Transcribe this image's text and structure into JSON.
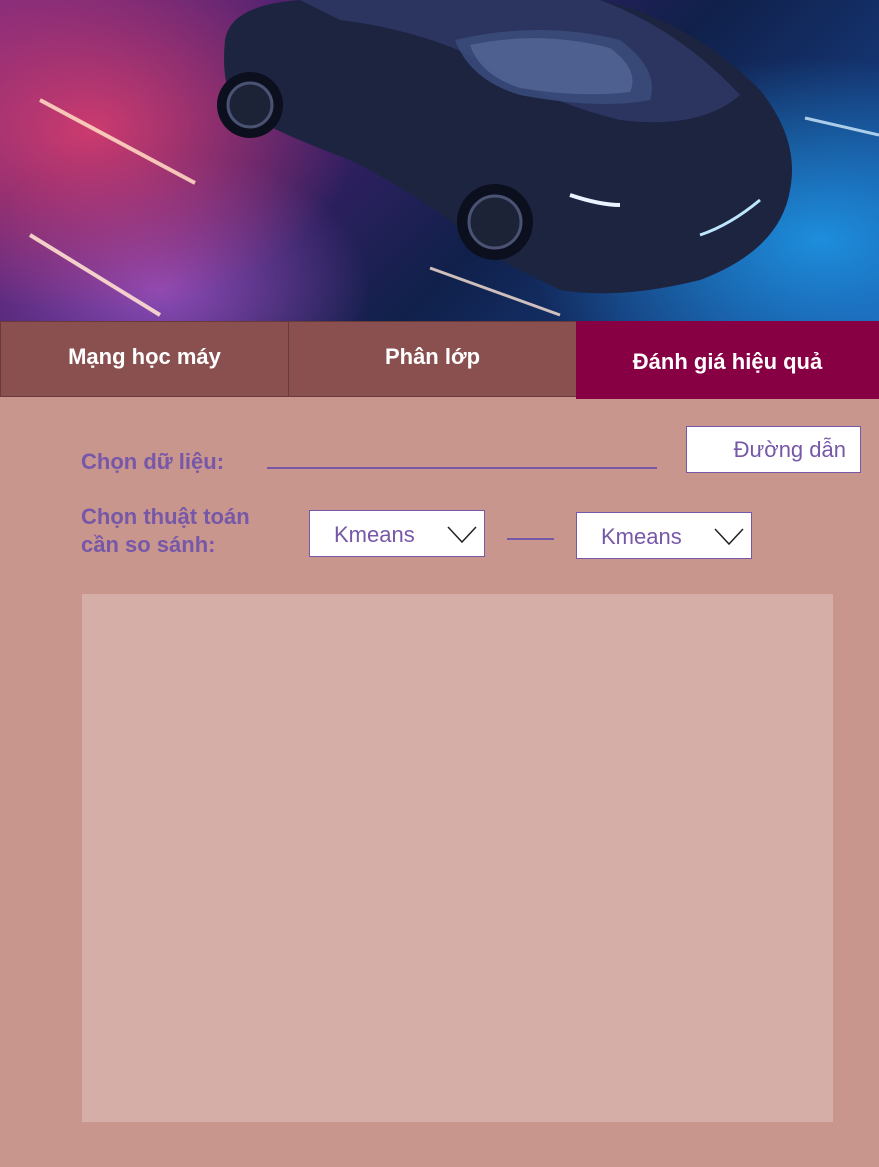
{
  "tabs": [
    {
      "label": "Mạng học máy"
    },
    {
      "label": "Phân lớp"
    },
    {
      "label": "Đánh giá hiệu quả"
    }
  ],
  "active_tab": "Đánh giá hiệu quả",
  "data_section": {
    "label": "Chọn dữ liệu:",
    "path_button": "Đường dẫn",
    "path_value": ""
  },
  "compare_section": {
    "label_line1": "Chọn thuật toán",
    "label_line2": "cần so sánh:",
    "algorithm_a": "Kmeans",
    "algorithm_b": "Kmeans"
  },
  "colors": {
    "background": "#c9968e",
    "tab": "#8a5050",
    "tab_active": "#880044",
    "accent": "#7657a8",
    "panel": "#d6aea8"
  },
  "icons": {
    "dropdown": "chevron-down-icon"
  }
}
